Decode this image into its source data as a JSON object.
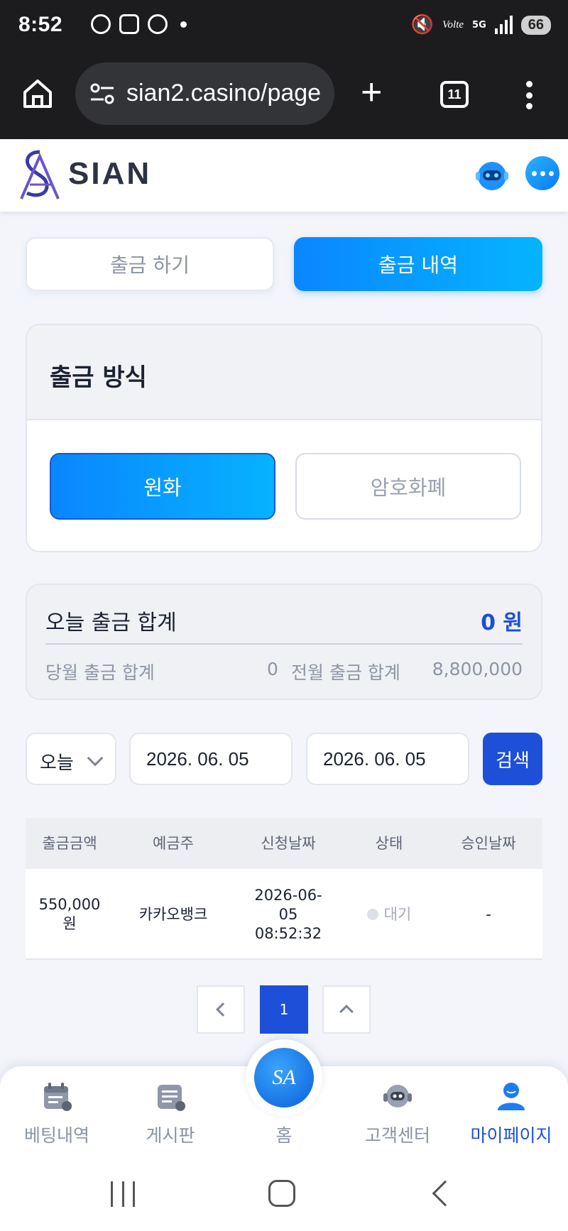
{
  "status_bar": {
    "time": "8:52",
    "volte": "Volte",
    "network": "5G",
    "battery": "66"
  },
  "browser": {
    "url": "sian2.casino/page",
    "tab_count": "11"
  },
  "site": {
    "logo_text": "SIAN",
    "logo_mark": "SA"
  },
  "tabs": {
    "withdraw": "출금 하기",
    "history": "출금 내역"
  },
  "method": {
    "title": "출금 방식",
    "krw": "원화",
    "crypto": "암호화폐"
  },
  "summary": {
    "today_label": "오늘 출금 합계",
    "today_value": "0 원",
    "month_label": "당월 출금 합계",
    "month_value": "0",
    "prev_label": "전월 출금 합계",
    "prev_value": "8,800,000"
  },
  "search": {
    "period": "오늘",
    "date_from": "2026. 06. 05",
    "date_to": "2026. 06. 05",
    "button": "검색"
  },
  "table": {
    "headers": [
      "출금금액",
      "예금주",
      "신청날짜",
      "상태",
      "승인날짜"
    ],
    "rows": [
      {
        "amount": "550,000\n원",
        "holder": "카카오뱅크",
        "requested": "2026-06-\n05\n08:52:32",
        "status": "대기",
        "approved": "-"
      }
    ]
  },
  "pagination": {
    "current": "1"
  },
  "bottom_nav": [
    {
      "label": "베팅내역",
      "icon": "calendar-icon"
    },
    {
      "label": "게시판",
      "icon": "board-icon"
    },
    {
      "label": "홈",
      "icon": "home-logo-icon"
    },
    {
      "label": "고객센터",
      "icon": "headset-icon"
    },
    {
      "label": "마이페이지",
      "icon": "user-icon"
    }
  ],
  "colors": {
    "accent": "#0a86ff",
    "primary_blue": "#1d4fd8",
    "dark_bar": "#1c1c1e"
  }
}
